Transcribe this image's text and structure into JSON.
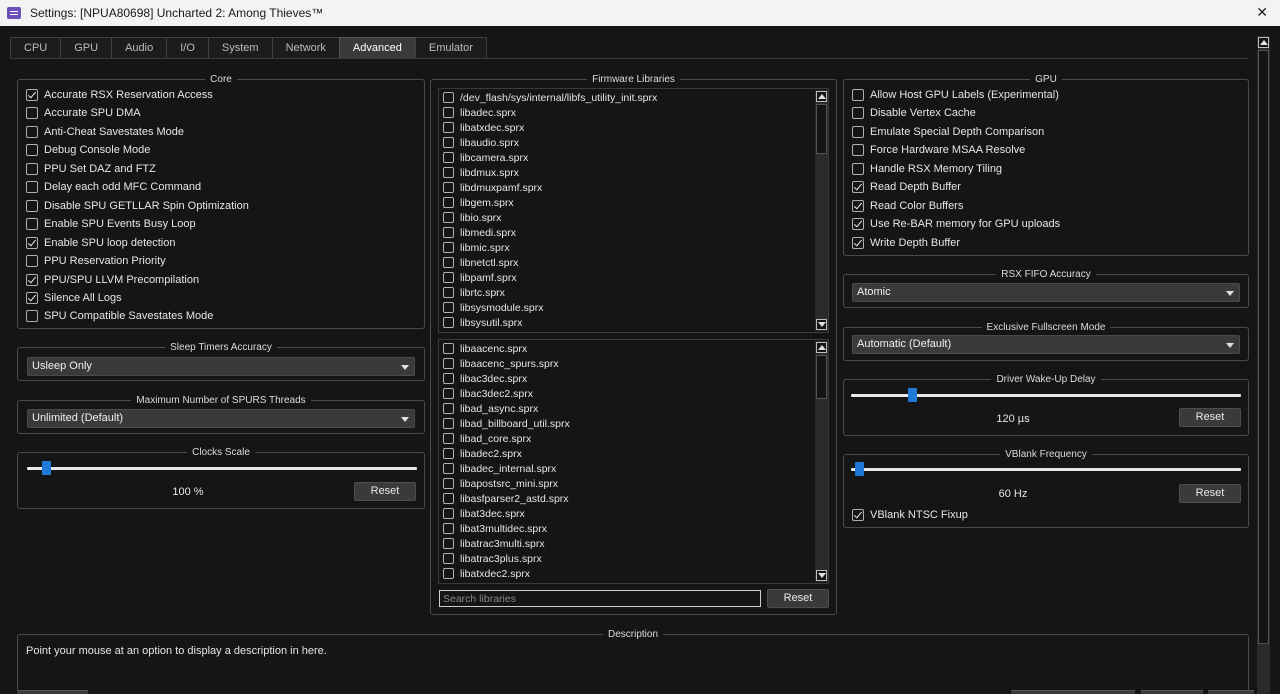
{
  "window": {
    "title": "Settings: [NPUA80698] Uncharted 2: Among Thieves™",
    "close_icon": "close-icon"
  },
  "tabs": [
    {
      "label": "CPU",
      "active": false
    },
    {
      "label": "GPU",
      "active": false
    },
    {
      "label": "Audio",
      "active": false
    },
    {
      "label": "I/O",
      "active": false
    },
    {
      "label": "System",
      "active": false
    },
    {
      "label": "Network",
      "active": false
    },
    {
      "label": "Advanced",
      "active": true
    },
    {
      "label": "Emulator",
      "active": false
    }
  ],
  "core": {
    "title": "Core",
    "options": [
      {
        "label": "Accurate RSX Reservation Access",
        "checked": true
      },
      {
        "label": "Accurate SPU DMA",
        "checked": false
      },
      {
        "label": "Anti-Cheat Savestates Mode",
        "checked": false
      },
      {
        "label": "Debug Console Mode",
        "checked": false
      },
      {
        "label": "PPU Set DAZ and FTZ",
        "checked": false
      },
      {
        "label": "Delay each odd MFC Command",
        "checked": false
      },
      {
        "label": "Disable SPU GETLLAR Spin Optimization",
        "checked": false
      },
      {
        "label": "Enable SPU Events Busy Loop",
        "checked": false
      },
      {
        "label": "Enable SPU loop detection",
        "checked": true
      },
      {
        "label": "PPU Reservation Priority",
        "checked": false
      },
      {
        "label": "PPU/SPU LLVM Precompilation",
        "checked": true
      },
      {
        "label": "Silence All Logs",
        "checked": true
      },
      {
        "label": "SPU Compatible Savestates Mode",
        "checked": false
      }
    ]
  },
  "sleep_timers": {
    "title": "Sleep Timers Accuracy",
    "value": "Usleep Only"
  },
  "spurs_threads": {
    "title": "Maximum Number of SPURS Threads",
    "value": "Unlimited (Default)"
  },
  "clocks_scale": {
    "title": "Clocks Scale",
    "value_text": "100 %",
    "level": 0.04,
    "reset_label": "Reset"
  },
  "firmware": {
    "title": "Firmware Libraries",
    "list1": [
      "/dev_flash/sys/internal/libfs_utility_init.sprx",
      "libadec.sprx",
      "libatxdec.sprx",
      "libaudio.sprx",
      "libcamera.sprx",
      "libdmux.sprx",
      "libdmuxpamf.sprx",
      "libgem.sprx",
      "libio.sprx",
      "libmedi.sprx",
      "libmic.sprx",
      "libnetctl.sprx",
      "libpamf.sprx",
      "librtc.sprx",
      "libsysmodule.sprx",
      "libsysutil.sprx"
    ],
    "list2": [
      "libaacenc.sprx",
      "libaacenc_spurs.sprx",
      "libac3dec.sprx",
      "libac3dec2.sprx",
      "libad_async.sprx",
      "libad_billboard_util.sprx",
      "libad_core.sprx",
      "libadec2.sprx",
      "libadec_internal.sprx",
      "libapostsrc_mini.sprx",
      "libasfparser2_astd.sprx",
      "libat3dec.sprx",
      "libat3multidec.sprx",
      "libatrac3multi.sprx",
      "libatrac3plus.sprx",
      "libatxdec2.sprx"
    ],
    "search_placeholder": "Search libraries",
    "reset_label": "Reset"
  },
  "gpu": {
    "title": "GPU",
    "options": [
      {
        "label": "Allow Host GPU Labels (Experimental)",
        "checked": false
      },
      {
        "label": "Disable Vertex Cache",
        "checked": false
      },
      {
        "label": "Emulate Special Depth Comparison",
        "checked": false
      },
      {
        "label": "Force Hardware MSAA Resolve",
        "checked": false
      },
      {
        "label": "Handle RSX Memory Tiling",
        "checked": false
      },
      {
        "label": "Read Depth Buffer",
        "checked": true
      },
      {
        "label": "Read Color Buffers",
        "checked": true
      },
      {
        "label": "Use Re-BAR memory for GPU uploads",
        "checked": true
      },
      {
        "label": "Write Depth Buffer",
        "checked": true
      }
    ]
  },
  "rsx_fifo": {
    "title": "RSX FIFO Accuracy",
    "value": "Atomic"
  },
  "exclusive_fullscreen": {
    "title": "Exclusive Fullscreen Mode",
    "value": "Automatic (Default)"
  },
  "driver_wakeup": {
    "title": "Driver Wake-Up Delay",
    "value_text": "120 µs",
    "level": 0.15,
    "reset_label": "Reset"
  },
  "vblank": {
    "title": "VBlank Frequency",
    "value_text": "60 Hz",
    "level": 0.01,
    "reset_label": "Reset",
    "ntsc_label": "VBlank NTSC Fixup",
    "ntsc_checked": true
  },
  "description": {
    "title": "Description",
    "text": "Point your mouse at an option to display a description in here."
  },
  "colors": {
    "accent": "#1e7ad6",
    "background": "#151515",
    "border": "#4a4a4a"
  }
}
